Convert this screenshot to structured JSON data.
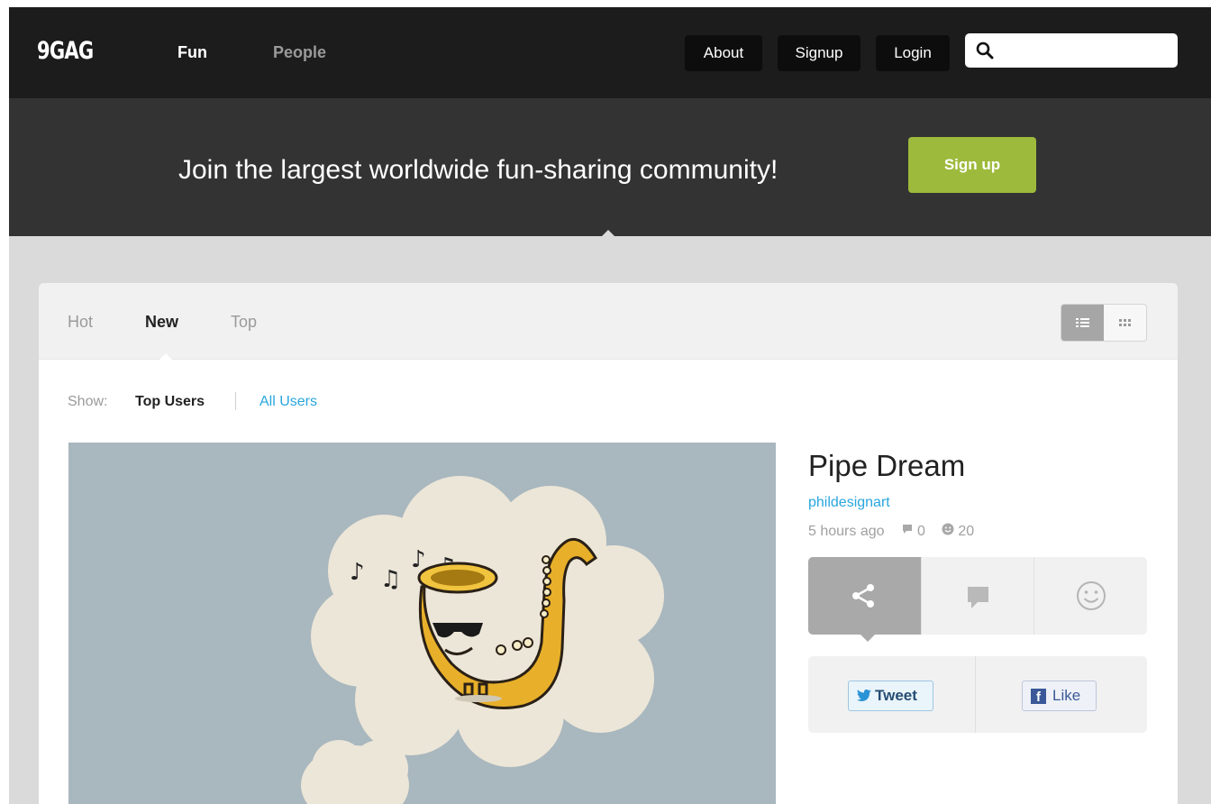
{
  "nav": {
    "logo": "9GAG",
    "links": [
      "Fun",
      "People"
    ],
    "buttons": {
      "about": "About",
      "signup": "Signup",
      "login": "Login"
    },
    "search": {
      "value": "",
      "placeholder": ""
    }
  },
  "banner": {
    "text": "Join the largest worldwide fun-sharing community!",
    "signup": "Sign up"
  },
  "tabs": {
    "hot": "Hot",
    "new": "New",
    "top": "Top",
    "active": "New",
    "view_modes": [
      "list-view-icon",
      "grid-view-icon"
    ],
    "active_view": "list"
  },
  "filter": {
    "label": "Show:",
    "top_users": "Top Users",
    "all_users": "All Users"
  },
  "post": {
    "title": "Pipe Dream",
    "author": "phildesignart",
    "time": "5 hours ago",
    "comments": "0",
    "reactions": "20",
    "image": "saxophone-dream-illustration",
    "actions": [
      "share-icon",
      "comment-icon",
      "smiley-icon"
    ],
    "social": {
      "tweet": "Tweet",
      "like": "Like"
    }
  },
  "colors": {
    "nav_bg": "#1c1c1c",
    "banner_bg": "#333333",
    "signup_green": "#9dba3c",
    "link_blue": "#29a6de",
    "page_bg": "#dadada"
  }
}
